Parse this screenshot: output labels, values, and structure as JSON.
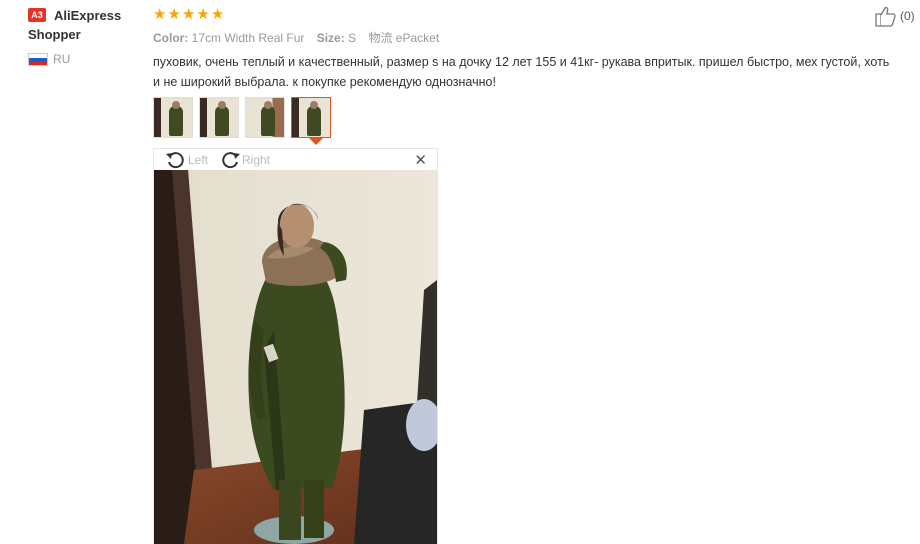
{
  "user": {
    "badge": "A3",
    "name": "AliExpress Shopper",
    "country_code": "RU"
  },
  "rating": {
    "stars": 5,
    "max": 5
  },
  "attributes": {
    "color_label": "Color:",
    "color_value": "17cm Width Real Fur",
    "size_label": "Size:",
    "size_value": "S",
    "shipping_label": "物流",
    "shipping_value": "ePacket"
  },
  "review": {
    "text": "пуховик, очень теплый и качественный, размер s на дочку 12 лет 155 и 41кг- рукава впритык. пришел быстро, мех густой, хоть и не широкий выбрала. к покупке рекомендую однозначно!"
  },
  "helpful": {
    "count": "(0)",
    "icon": "thumbs-up-icon"
  },
  "thumbnails": {
    "count": 4,
    "active_index": 3
  },
  "viewer": {
    "rotate_left_label": "Left",
    "rotate_right_label": "Right",
    "close_icon": "close-icon"
  },
  "colors": {
    "star": "#f7a500",
    "badge": "#e43225",
    "active_border": "#e5531a",
    "muted_text": "#999999"
  }
}
